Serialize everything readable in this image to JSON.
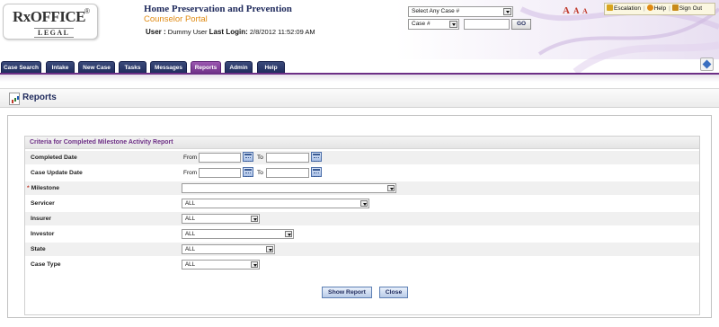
{
  "header": {
    "logo_main": "RxOFFICE",
    "logo_reg": "®",
    "logo_sub": "LEGAL",
    "app_title": "Home Preservation and Prevention",
    "app_subtitle": "Counselor Portal",
    "user_label": "User :",
    "user_name": "Dummy User",
    "last_login_label": "Last Login:",
    "last_login_value": "2/8/2012 11:52:09 AM",
    "case_select": "Select Any Case #",
    "case_type_select": "Case #",
    "case_search_value": "",
    "go_label": "GO",
    "font_size_labels": [
      "A",
      "A",
      "A"
    ],
    "links": {
      "escalation": "Escalation",
      "help": "Help",
      "sign_out": "Sign Out"
    }
  },
  "nav": {
    "tabs": [
      {
        "label": "Case Search",
        "active": false
      },
      {
        "label": "Intake",
        "active": false
      },
      {
        "label": "New Case",
        "active": false
      },
      {
        "label": "Tasks",
        "active": false
      },
      {
        "label": "Messages",
        "active": false
      },
      {
        "label": "Reports",
        "active": true
      },
      {
        "label": "Admin",
        "active": false
      },
      {
        "label": "Help",
        "active": false
      }
    ]
  },
  "page": {
    "title": "Reports"
  },
  "form": {
    "title": "Criteria for Completed Milestone Activity Report",
    "from_label": "From",
    "to_label": "To",
    "completed_date": {
      "label": "Completed Date",
      "from": "",
      "to": ""
    },
    "case_update_date": {
      "label": "Case Update Date",
      "from": "",
      "to": ""
    },
    "milestone": {
      "label": "Milestone",
      "required_mark": "*",
      "value": ""
    },
    "servicer": {
      "label": "Servicer",
      "value": "ALL"
    },
    "insurer": {
      "label": "Insurer",
      "value": "ALL"
    },
    "investor": {
      "label": "Investor",
      "value": "ALL"
    },
    "state": {
      "label": "State",
      "value": "ALL"
    },
    "case_type": {
      "label": "Case Type",
      "value": "ALL"
    },
    "buttons": {
      "show_report": "Show Report",
      "close": "Close"
    }
  },
  "colors": {
    "nav_tab": "#1f2a5c",
    "active_tab": "#6d2f86",
    "section_title": "#6d2f86",
    "subtitle": "#e08a12",
    "required": "#c0392b"
  }
}
